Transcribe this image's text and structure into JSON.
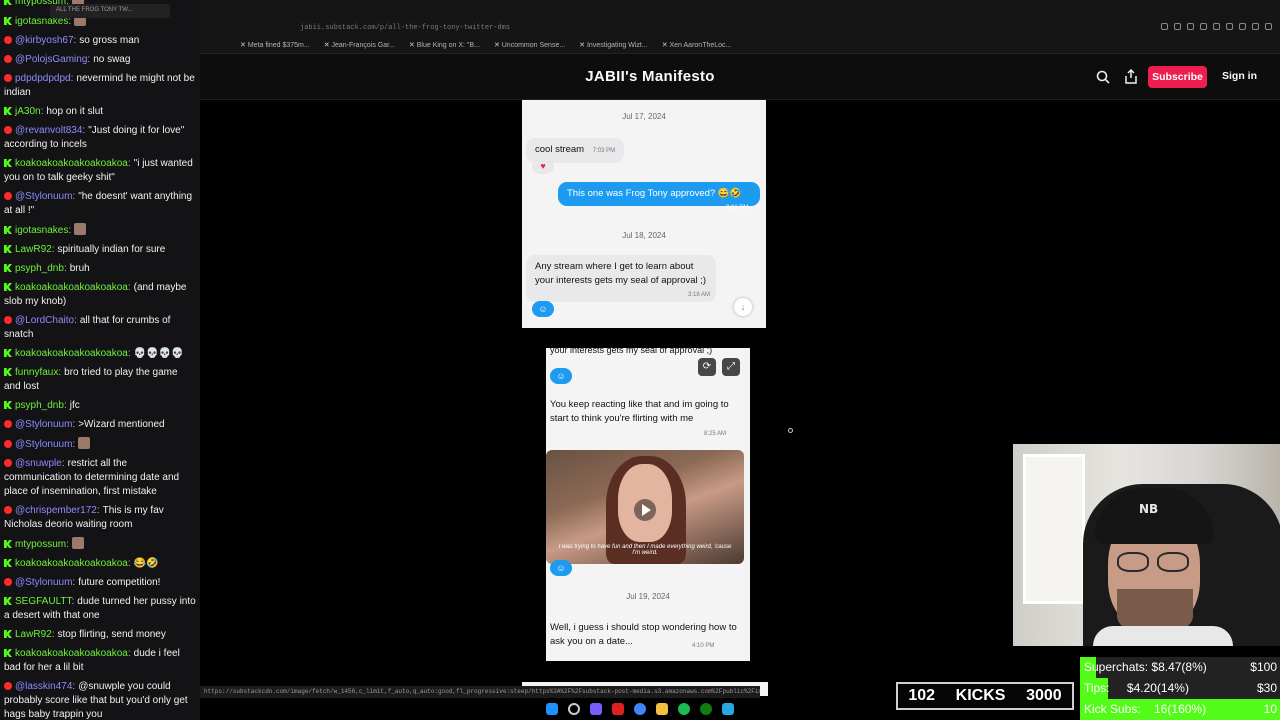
{
  "chat": {
    "messages": [
      {
        "platform": "kick",
        "user": "mtypossum",
        "text": ""
      },
      {
        "platform": "kick",
        "user": "igotasnakes",
        "text": ""
      },
      {
        "platform": "yt",
        "user": "@kirbyosh67",
        "text": "so gross man"
      },
      {
        "platform": "yt",
        "user": "@PolojsGaming",
        "text": "no swag"
      },
      {
        "platform": "yt",
        "user": "pdpdpdpdpd",
        "text": "nevermind he might not be indian"
      },
      {
        "platform": "kick",
        "user": "jA30n",
        "text": "hop on it slut"
      },
      {
        "platform": "yt",
        "user": "@revanvolt834",
        "text": "\"Just doing it for love\" according to incels"
      },
      {
        "platform": "kick",
        "user": "koakoakoakoakoakoakoa",
        "text": "\"i just wanted you on to talk geeky shit\""
      },
      {
        "platform": "yt",
        "user": "@Stylonuum",
        "text": "\"he doesnt' want anything at all !\""
      },
      {
        "platform": "kick",
        "user": "igotasnakes",
        "text": ""
      },
      {
        "platform": "kick",
        "user": "LawR92",
        "text": "spiritually indian for sure"
      },
      {
        "platform": "kick",
        "user": "psyph_dnb",
        "text": "bruh"
      },
      {
        "platform": "kick",
        "user": "koakoakoakoakoakoakoa",
        "text": "(and maybe slob my knob)"
      },
      {
        "platform": "yt",
        "user": "@LordChaito",
        "text": "all that for crumbs of snatch"
      },
      {
        "platform": "kick",
        "user": "koakoakoakoakoakoakoa",
        "text": "💀💀💀💀"
      },
      {
        "platform": "kick",
        "user": "funnyfaux",
        "text": "bro tried to play the game and lost"
      },
      {
        "platform": "kick",
        "user": "psyph_dnb",
        "text": "jfc"
      },
      {
        "platform": "yt",
        "user": "@Stylonuum",
        "text": ">Wizard mentioned"
      },
      {
        "platform": "yt",
        "user": "@Stylonuum",
        "text": ""
      },
      {
        "platform": "yt",
        "user": "@snuwple",
        "text": "restrict all the communication to determining date and place of insemination, first mistake"
      },
      {
        "platform": "yt",
        "user": "@chrispember172",
        "text": "This is my fav Nicholas deorio waiting room"
      },
      {
        "platform": "kick",
        "user": "mtypossum",
        "text": ""
      },
      {
        "platform": "kick",
        "user": "koakoakoakoakoakoakoa",
        "text": "😂🤣"
      },
      {
        "platform": "yt",
        "user": "@Stylonuum",
        "text": "future competition!"
      },
      {
        "platform": "kick",
        "user": "SEGFAULTT",
        "text": "dude turned her pussy into a desert with that one"
      },
      {
        "platform": "kick",
        "user": "LawR92",
        "text": "stop flirting, send money"
      },
      {
        "platform": "kick",
        "user": "koakoakoakoakoakoakoa",
        "text": "dude i feel bad for her a lil bit"
      },
      {
        "platform": "yt",
        "user": "@lasskin474",
        "text": "@snuwple you could probably score like that but you'd only get hags baby trappin you"
      }
    ]
  },
  "browser": {
    "tab_title": "ALL THE FROG TONY TW...",
    "url": "jabii.substack.com/p/all-the-frog-tony-twitter-dms",
    "bookmarks": [
      "Meta fined $375m...",
      "Jean-François Gar...",
      "Blue King on X: \"B...",
      "Uncommon Sense...",
      "Investigating Wizt...",
      "Xen AaronTheLoc..."
    ],
    "status_url": "https://substackcdn.com/image/fetch/w_1456,c_limit,f_auto,q_auto:good,fl_progressive:steep/https%3A%2F%2Fsubstack-post-media.s3.amazonaws.com%2Fpublic%2Fimages%2F79ff22d-2198-4c9a-ba30-56e5897c988d_326x501.png"
  },
  "substack": {
    "publication_title": "JABII's Manifesto",
    "subscribe_label": "Subscribe",
    "signin_label": "Sign in",
    "accent": "#ef1d4f"
  },
  "screenshot1": {
    "date1": "Jul 17, 2024",
    "msg1": "cool stream",
    "msg1_time": "7:03 PM",
    "reply": "This one was Frog Tony approved? 😅🤣",
    "reply_time": "9:01 PM",
    "date2": "Jul 18, 2024",
    "msg2": "Any stream where I get to learn about your interests gets my seal of approval ;)",
    "msg2_time": "3:18 AM"
  },
  "screenshot2": {
    "top_cut": "your interests gets my seal of approval ;)",
    "msg": "You keep reacting like that and im going to start to think you're flirting with me",
    "msg_time": "8:25 AM",
    "gif_caption": "I was trying to have fun and then I made everything weird, 'cause I'm weird.",
    "date": "Jul 19, 2024",
    "msg2": "Well, i guess i should stop wondering how to ask you on a date...",
    "msg2_time": "4:10 PM"
  },
  "overlay": {
    "kick_count": "102",
    "kick_label": "KICKS",
    "kick_goal": "3000",
    "superchats_label": "Superchats:",
    "superchats_value": "$8.47(8%)",
    "superchats_goal": "$100",
    "superchats_fraction": 0.08,
    "tips_label": "Tips:",
    "tips_value": "$4.20(14%)",
    "tips_goal": "$30",
    "tips_fraction": 0.14,
    "kicksubs_label": "Kick Subs:",
    "kicksubs_value": "16(160%)",
    "kicksubs_goal": "10",
    "kicksubs_fraction": 1.0,
    "fill_color": "#53fc18"
  }
}
